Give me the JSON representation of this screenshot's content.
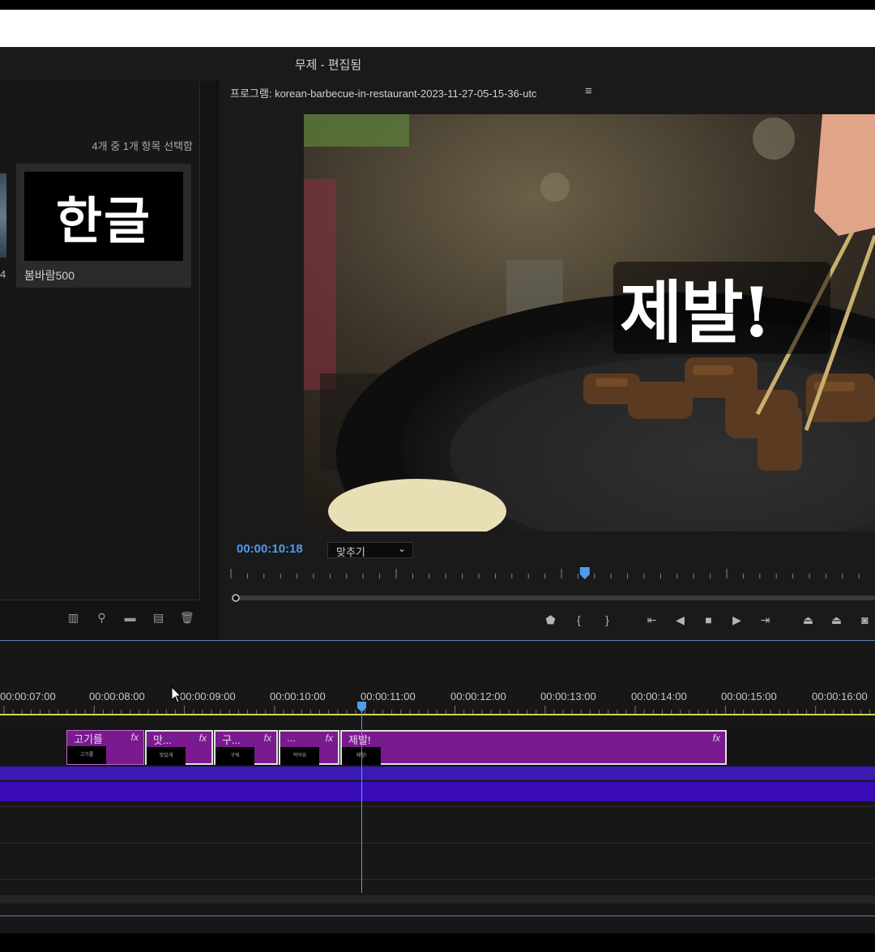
{
  "window": {
    "title": "무제 - 편집됨"
  },
  "project_panel": {
    "selection_count": "4개 중 1개 항목 선택함",
    "left_item_label": "4",
    "items": [
      {
        "label": "봄바람500",
        "thumb_text": "한글"
      }
    ],
    "tools": [
      "list-view-icon",
      "search-icon",
      "folder-icon",
      "new-item-icon",
      "trash-icon"
    ]
  },
  "program_monitor": {
    "title": "프로그램: korean-barbecue-in-restaurant-2023-11-27-05-15-36-utc",
    "menu_icon": "≡",
    "overlay_text": "제발!",
    "timecode": "00:00:10:18",
    "fit_label": "맞추기",
    "playhead_position": 0.55,
    "controls": [
      "marker-icon",
      "mark-in-icon",
      "mark-out-icon",
      "go-to-in-icon",
      "step-back-icon",
      "stop-icon",
      "step-forward-icon",
      "go-to-out-icon",
      "lift-icon",
      "extract-icon",
      "camera-icon"
    ]
  },
  "timeline": {
    "timecodes": [
      "00:00:07:00",
      "00:00:08:00",
      "00:00:09:00",
      "00:00:10:00",
      "00:00:11:00",
      "00:00:12:00",
      "00:00:13:00",
      "00:00:14:00",
      "00:00:15:00",
      "00:00:16:00"
    ],
    "clips": [
      {
        "title": "고기를",
        "mini": "고기를"
      },
      {
        "title": "맛...",
        "mini": "맛있게"
      },
      {
        "title": "구...",
        "mini": "구워"
      },
      {
        "title": "...",
        "mini": "먹어요"
      },
      {
        "title": "제발!",
        "mini": "제발!"
      }
    ]
  },
  "colors": {
    "accent": "#4f9bf0",
    "clip": "#7a1a8f",
    "audio": "#3a0cb8",
    "in_out_bar": "#d3d34a"
  }
}
